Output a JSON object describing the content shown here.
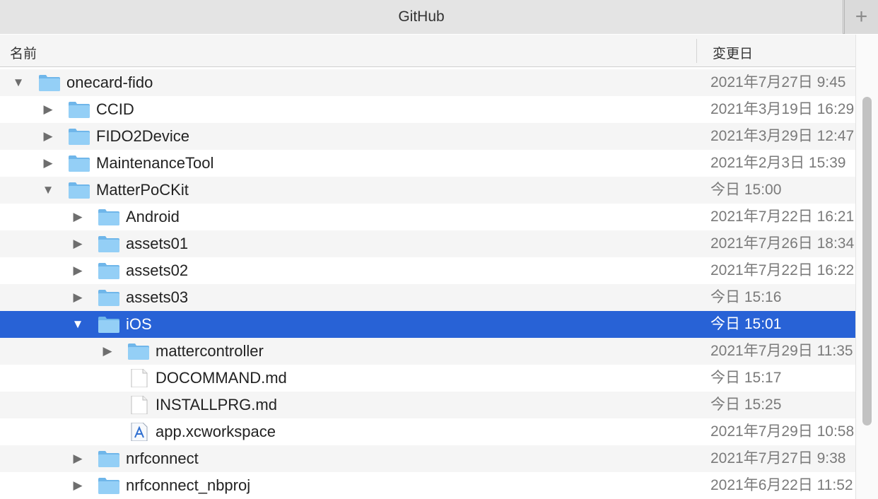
{
  "window": {
    "tab_title": "GitHub",
    "new_tab_icon": "plus-icon"
  },
  "columns": {
    "name": "名前",
    "date": "変更日"
  },
  "colors": {
    "selection": "#2862d6",
    "folder": "#8ecbf4"
  },
  "rows": [
    {
      "name": "onecard-fido",
      "date": "2021年7月27日 9:45",
      "depth": 0,
      "type": "folder",
      "expanded": true
    },
    {
      "name": "CCID",
      "date": "2021年3月19日 16:29",
      "depth": 1,
      "type": "folder",
      "expanded": false
    },
    {
      "name": "FIDO2Device",
      "date": "2021年3月29日 12:47",
      "depth": 1,
      "type": "folder",
      "expanded": false
    },
    {
      "name": "MaintenanceTool",
      "date": "2021年2月3日 15:39",
      "depth": 1,
      "type": "folder",
      "expanded": false
    },
    {
      "name": "MatterPoCKit",
      "date": "今日 15:00",
      "depth": 1,
      "type": "folder",
      "expanded": true
    },
    {
      "name": "Android",
      "date": "2021年7月22日 16:21",
      "depth": 2,
      "type": "folder",
      "expanded": false
    },
    {
      "name": "assets01",
      "date": "2021年7月26日 18:34",
      "depth": 2,
      "type": "folder",
      "expanded": false
    },
    {
      "name": "assets02",
      "date": "2021年7月22日 16:22",
      "depth": 2,
      "type": "folder",
      "expanded": false
    },
    {
      "name": "assets03",
      "date": "今日 15:16",
      "depth": 2,
      "type": "folder",
      "expanded": false
    },
    {
      "name": "iOS",
      "date": "今日 15:01",
      "depth": 2,
      "type": "folder",
      "expanded": true,
      "selected": true
    },
    {
      "name": "mattercontroller",
      "date": "2021年7月29日 11:35",
      "depth": 3,
      "type": "folder",
      "expanded": false
    },
    {
      "name": "DOCOMMAND.md",
      "date": "今日 15:17",
      "depth": 3,
      "type": "file"
    },
    {
      "name": "INSTALLPRG.md",
      "date": "今日 15:25",
      "depth": 3,
      "type": "file"
    },
    {
      "name": "app.xcworkspace",
      "date": "2021年7月29日 10:58",
      "depth": 3,
      "type": "workspace"
    },
    {
      "name": "nrfconnect",
      "date": "2021年7月27日 9:38",
      "depth": 2,
      "type": "folder",
      "expanded": false
    },
    {
      "name": "nrfconnect_nbproj",
      "date": "2021年6月22日 11:52",
      "depth": 2,
      "type": "folder",
      "expanded": false
    }
  ]
}
